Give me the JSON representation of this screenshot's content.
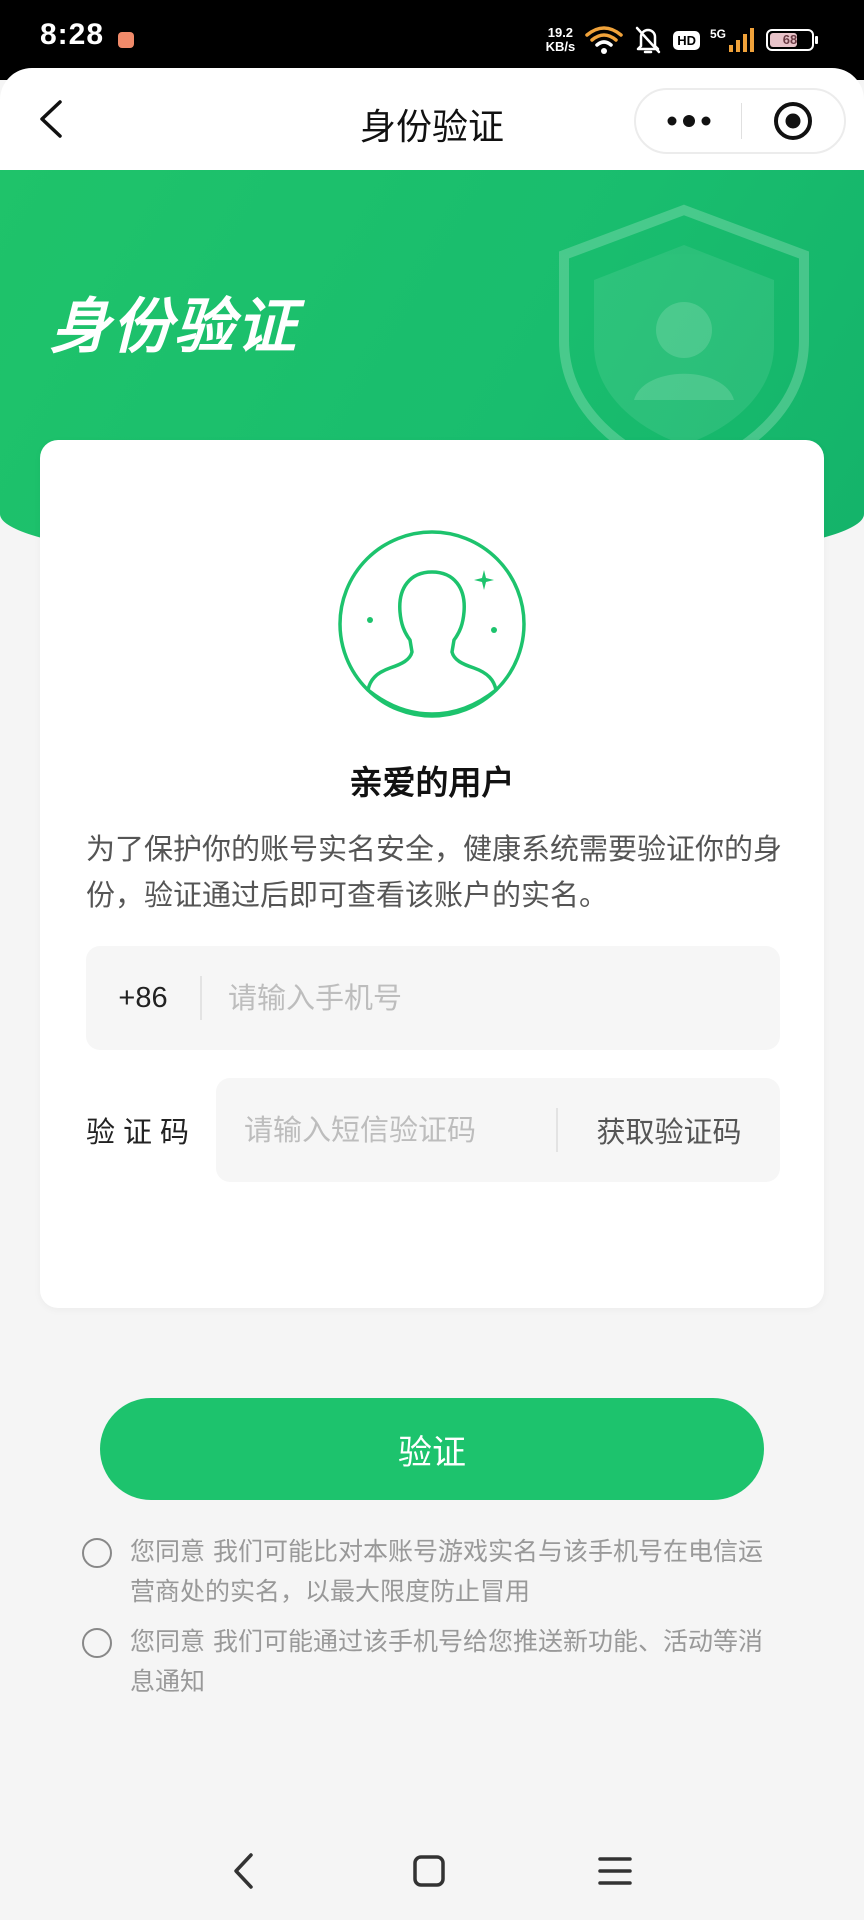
{
  "status_bar": {
    "time": "8:28",
    "net_speed_value": "19.2",
    "net_speed_unit": "KB/s",
    "hd_label": "HD",
    "network_label": "5G",
    "battery_level": "68",
    "battery_fraction": 0.68
  },
  "nav": {
    "title": "身份验证"
  },
  "banner": {
    "title": "身份验证"
  },
  "card": {
    "greeting": "亲爱的用户",
    "description": "为了保护你的账号实名安全，健康系统需要验证你的身份，验证通过后即可查看该账户的实名。",
    "phone": {
      "country_code": "+86",
      "placeholder": "请输入手机号"
    },
    "code": {
      "label": "验证码",
      "placeholder": "请输入短信验证码",
      "get_code_label": "获取验证码"
    }
  },
  "verify_button": {
    "label": "验证"
  },
  "agreements": [
    {
      "text": "您同意 我们可能比对本账号游戏实名与该手机号在电信运营商处的实名，以最大限度防止冒用"
    },
    {
      "text": "您同意 我们可能通过该手机号给您推送新功能、活动等消息通知"
    }
  ],
  "colors": {
    "brand_green": "#1dc36d",
    "status_bar_bg": "#000000",
    "page_bg": "#f5f5f5"
  }
}
